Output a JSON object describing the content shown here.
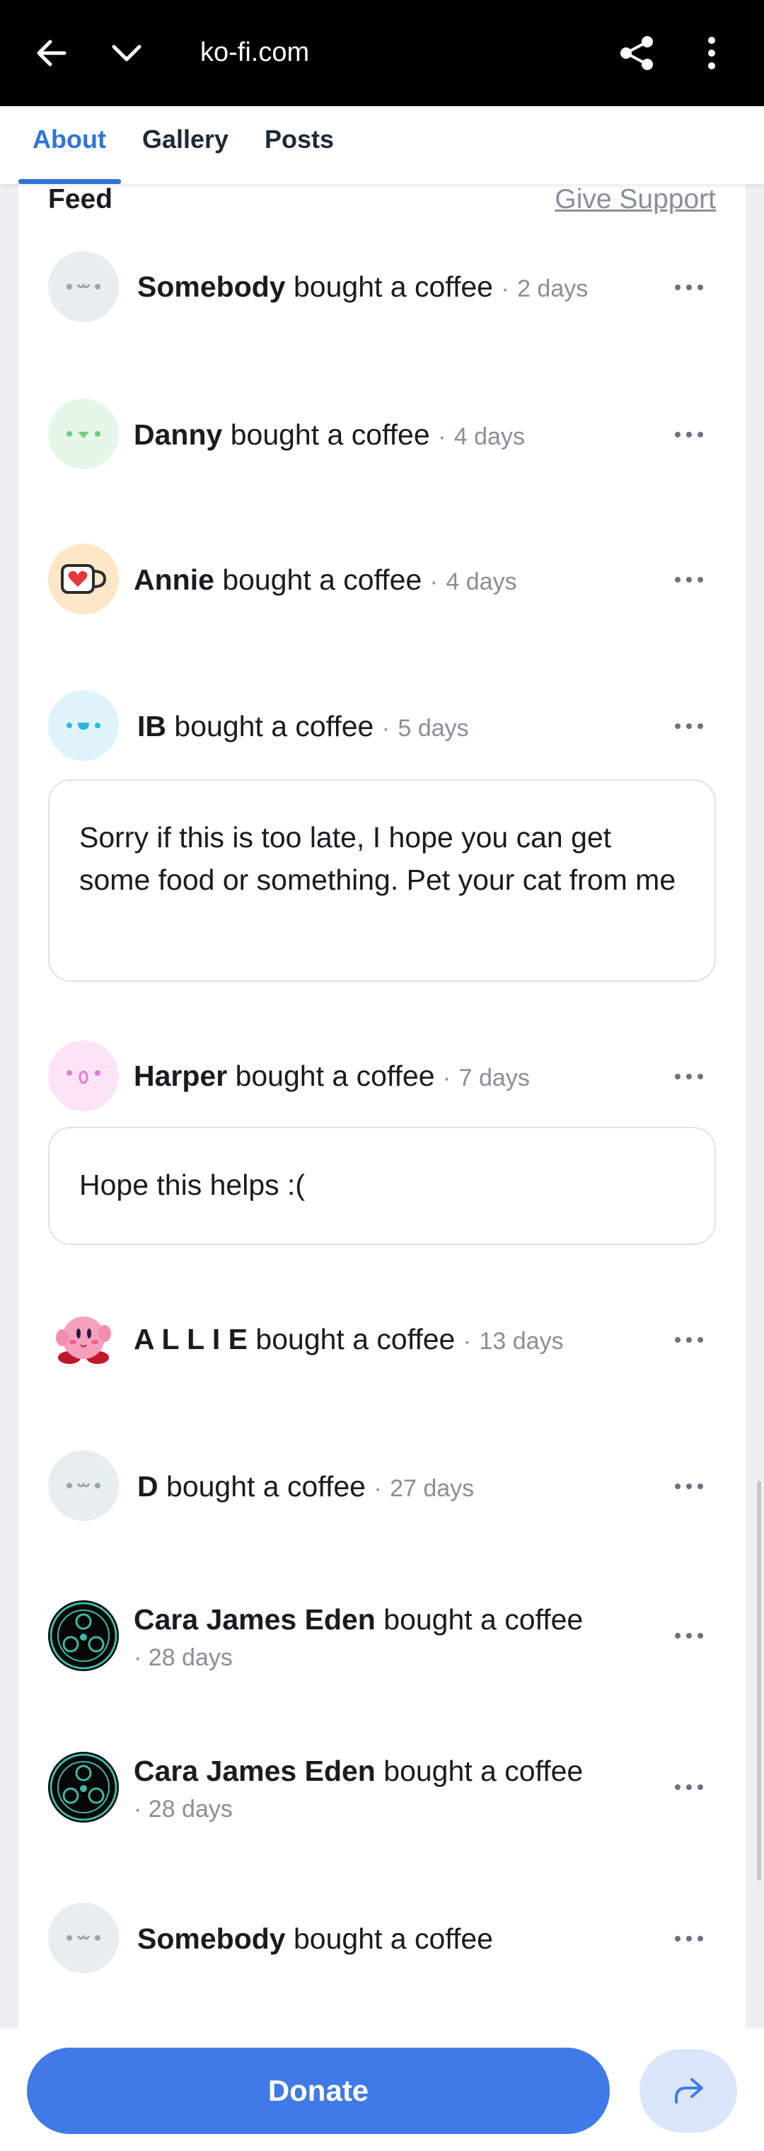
{
  "browser": {
    "url": "ko-fi.com"
  },
  "tabs": [
    {
      "label": "About",
      "active": true
    },
    {
      "label": "Gallery",
      "active": false
    },
    {
      "label": "Posts",
      "active": false
    }
  ],
  "feed": {
    "title": "Feed",
    "give_support": "Give Support",
    "entries": [
      {
        "name": "Somebody",
        "action": "bought a coffee",
        "time": "2 days",
        "avatar": "grey-face-icon"
      },
      {
        "name": "Danny",
        "action": "bought a coffee",
        "time": "4 days",
        "avatar": "green-face-icon"
      },
      {
        "name": "Annie",
        "action": "bought a coffee",
        "time": "4 days",
        "avatar": "heart-cup-icon"
      },
      {
        "name": "IB",
        "action": "bought a coffee",
        "time": "5 days",
        "avatar": "blue-face-icon",
        "message": "Sorry if this is too late, I hope you can get some food or something. Pet your cat from me"
      },
      {
        "name": "Harper",
        "action": "bought a coffee",
        "time": "7 days",
        "avatar": "pink-face-icon",
        "message": "Hope this helps :("
      },
      {
        "name": "A L L I E",
        "action": "bought a coffee",
        "time": "13 days",
        "avatar": "kirby-avatar"
      },
      {
        "name": "D",
        "action": "bought a coffee",
        "time": "27 days",
        "avatar": "grey-face-icon"
      },
      {
        "name": "Cara James Eden",
        "action": "bought a coffee",
        "time": "28 days",
        "avatar": "teal-emblem-avatar"
      },
      {
        "name": "Cara James Eden",
        "action": "bought a coffee",
        "time": "28 days",
        "avatar": "teal-emblem-avatar"
      },
      {
        "name": "Somebody",
        "action": "bought a coffee",
        "avatar": "grey-face-icon"
      }
    ]
  },
  "footer": {
    "donate_label": "Donate"
  },
  "colors": {
    "accent": "#3f7ae6",
    "tab_active": "#2f74d8",
    "muted": "#8a8f98",
    "topbar": "#000000"
  }
}
